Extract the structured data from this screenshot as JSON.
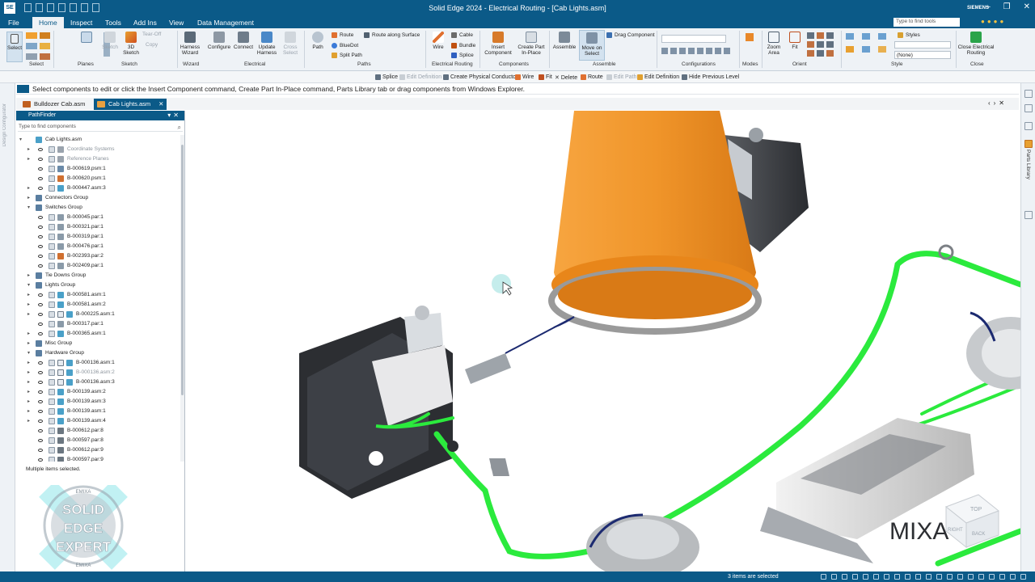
{
  "app": {
    "title": "Solid Edge 2024 - Electrical Routing - [Cab Lights.asm]",
    "brand": "SIEMENS",
    "logo": "SE"
  },
  "menu": {
    "file": "File",
    "tabs": [
      "Home",
      "Inspect",
      "Tools",
      "Add Ins",
      "View",
      "Data Management"
    ],
    "search_placeholder": "Type to find tools"
  },
  "ribbon": {
    "select": "Select",
    "sketch": "Sketch",
    "tear_off": "Tear-Off",
    "copy": "Copy",
    "sketch3d": "3D Sketch",
    "planes": "Planes",
    "harness_wizard": "Harness Wizard",
    "configure": "Configure",
    "connect": "Connect",
    "update_harness": "Update Harness",
    "cross_select": "Cross Select",
    "path": "Path",
    "route": "Route",
    "route_along_surface": "Route along Surface",
    "bluedot": "BlueDot",
    "split_path": "Split Path",
    "wire": "Wire",
    "cable": "Cable",
    "bundle": "Bundle",
    "splice": "Splice",
    "insert_component": "Insert Component",
    "create_part_in_place": "Create Part In-Place",
    "assemble": "Assemble",
    "move_on_select": "Move on Select",
    "drag_component": "Drag Component",
    "zoom_area": "Zoom Area",
    "fit": "Fit",
    "styles": "Styles",
    "styles_value": "(None)",
    "close_er": "Close Electrical Routing",
    "groups": {
      "select": "Select",
      "sketch": "Sketch",
      "planes": "Planes",
      "wizard": "Wizard",
      "electrical": "Electrical",
      "paths": "Paths",
      "electrical_routing": "Electrical Routing",
      "components": "Components",
      "assemble": "Assemble",
      "configurations": "Configurations",
      "modes": "Modes",
      "orient": "Orient",
      "style": "Style",
      "close": "Close"
    }
  },
  "command_bar": {
    "splice": "Splice",
    "edit_definition": "Edit Definition",
    "create_physical_conductor": "Create Physical Conductor",
    "wire": "Wire",
    "fit": "Fit",
    "delete": "Delete",
    "route": "Route",
    "edit_path": "Edit Path",
    "edit_definition2": "Edit Definition",
    "hide_previous_level": "Hide Previous Level"
  },
  "prompt": "Select components to edit or click the Insert Component command, Create Part In-Place command, Parts Library tab or drag components from Windows Explorer.",
  "left_tab": "Design Configurator",
  "documents": [
    {
      "name": "Bulldozer Cab.asm"
    },
    {
      "name": "Cab Lights.asm"
    }
  ],
  "pathfinder": {
    "title": "PathFinder",
    "search_placeholder": "Type to find components",
    "status": "Multiple items selected."
  },
  "tree": [
    {
      "label": "Cab Lights.asm",
      "level": 0,
      "exp": "▾",
      "icon": "asm",
      "eye": false
    },
    {
      "label": "Coordinate Systems",
      "level": 1,
      "exp": "▸",
      "icon": "sys",
      "eye": true,
      "grey": true
    },
    {
      "label": "Reference Planes",
      "level": 1,
      "exp": "▸",
      "icon": "sys",
      "eye": true,
      "grey": true
    },
    {
      "label": "B-000619.psm:1",
      "level": 1,
      "exp": "",
      "icon": "psm",
      "eye": true
    },
    {
      "label": "B-000620.psm:1",
      "level": 1,
      "exp": "",
      "icon": "psm2",
      "eye": true
    },
    {
      "label": "B-000447.asm:3",
      "level": 1,
      "exp": "▸",
      "icon": "asm",
      "eye": true
    },
    {
      "label": "Connectors Group",
      "level": 1,
      "exp": "▸",
      "icon": "grp",
      "eye": false
    },
    {
      "label": "Switches Group",
      "level": 1,
      "exp": "▾",
      "icon": "grp",
      "eye": false
    },
    {
      "label": "B-000045.par:1",
      "level": 2,
      "exp": "",
      "icon": "par",
      "eye": true
    },
    {
      "label": "B-000321.par:1",
      "level": 2,
      "exp": "",
      "icon": "par",
      "eye": true
    },
    {
      "label": "B-000319.par:1",
      "level": 2,
      "exp": "",
      "icon": "par",
      "eye": true
    },
    {
      "label": "B-000476.par:1",
      "level": 2,
      "exp": "",
      "icon": "par",
      "eye": true
    },
    {
      "label": "B-002393.par:2",
      "level": 2,
      "exp": "",
      "icon": "par2",
      "eye": true
    },
    {
      "label": "B-002409.par:1",
      "level": 2,
      "exp": "",
      "icon": "par",
      "eye": true
    },
    {
      "label": "Tie Downs Group",
      "level": 1,
      "exp": "▸",
      "icon": "grp",
      "eye": false
    },
    {
      "label": "Lights Group",
      "level": 1,
      "exp": "▾",
      "icon": "grp",
      "eye": false
    },
    {
      "label": "B-000581.asm:1",
      "level": 2,
      "exp": "▸",
      "icon": "asm",
      "eye": true
    },
    {
      "label": "B-000581.asm:2",
      "level": 2,
      "exp": "▸",
      "icon": "asm",
      "eye": true
    },
    {
      "label": "B-000225.asm:1",
      "level": 2,
      "exp": "▸",
      "icon": "asm",
      "eye": true,
      "link": true
    },
    {
      "label": "B-000317.par:1",
      "level": 2,
      "exp": "",
      "icon": "par",
      "eye": true
    },
    {
      "label": "B-000365.asm:1",
      "level": 2,
      "exp": "▸",
      "icon": "asm",
      "eye": true
    },
    {
      "label": "Misc Group",
      "level": 1,
      "exp": "▸",
      "icon": "grp",
      "eye": false
    },
    {
      "label": "Hardware Group",
      "level": 1,
      "exp": "▾",
      "icon": "grp",
      "eye": false
    },
    {
      "label": "B-000136.asm:1",
      "level": 2,
      "exp": "▸",
      "icon": "asm",
      "eye": true,
      "link": true
    },
    {
      "label": "B-000136.asm:2",
      "level": 2,
      "exp": "▸",
      "icon": "asm",
      "eye": true,
      "link": true,
      "grey": true
    },
    {
      "label": "B-000136.asm:3",
      "level": 2,
      "exp": "▸",
      "icon": "asm",
      "eye": true,
      "link": true
    },
    {
      "label": "B-000139.asm:2",
      "level": 2,
      "exp": "▸",
      "icon": "asm",
      "eye": true
    },
    {
      "label": "B-000139.asm:3",
      "level": 2,
      "exp": "▸",
      "icon": "asm",
      "eye": true
    },
    {
      "label": "B-000139.asm:1",
      "level": 2,
      "exp": "▸",
      "icon": "asm",
      "eye": true
    },
    {
      "label": "B-000139.asm:4",
      "level": 2,
      "exp": "▸",
      "icon": "asm",
      "eye": true
    },
    {
      "label": "B-000612.par:8",
      "level": 2,
      "exp": "",
      "icon": "par3",
      "eye": true
    },
    {
      "label": "B-000597.par:8",
      "level": 2,
      "exp": "",
      "icon": "par3",
      "eye": true
    },
    {
      "label": "B-000612.par:9",
      "level": 2,
      "exp": "",
      "icon": "par3",
      "eye": true
    },
    {
      "label": "B-000597.par:9",
      "level": 2,
      "exp": "",
      "icon": "par3",
      "eye": true
    }
  ],
  "watermark": {
    "line1": "SOLID",
    "line2": "EDGE",
    "line3": "EXPERT",
    "ring": "EMIXA"
  },
  "right_panel": {
    "parts_library": "Parts Library"
  },
  "viewport": {
    "cube_top": "TOP",
    "cube_right": "RIGHT",
    "cube_back": "BACK",
    "mixa": "MIXA"
  },
  "status": {
    "message": "3 items are selected"
  },
  "colors": {
    "accent": "#0b5a88",
    "wire_green": "#2bea3d",
    "beacon_orange": "#f08a1e"
  }
}
